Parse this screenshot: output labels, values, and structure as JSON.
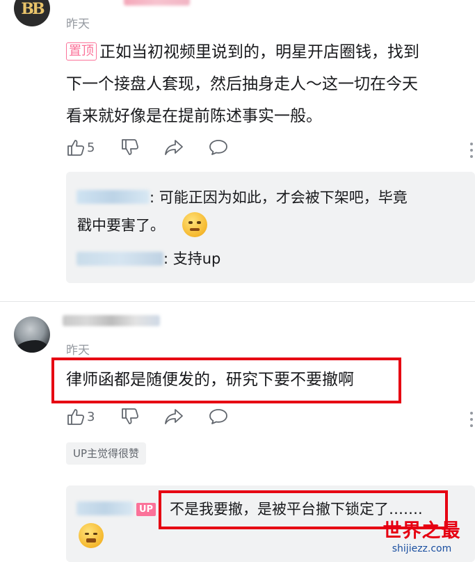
{
  "comments": [
    {
      "avatar_text": "BB",
      "time": "昨天",
      "pinned_label": "置顶",
      "lines": [
        "正如当初视频里说到的，明星开店圈钱，找到",
        "下一个接盘人套现，然后抽身走人～这一切在今天",
        "看来就好像是在提前陈述事实一般。"
      ],
      "like_count": "5",
      "replies": [
        {
          "lines": [
            ": 可能正因为如此，才会被下架吧，毕竟",
            "戳中要害了。"
          ],
          "emoji": "thinking-face-emoji"
        },
        {
          "lines": [
            ": 支持up"
          ]
        }
      ]
    },
    {
      "time": "昨天",
      "lines": [
        "律师函都是随便发的，研究下要不要撤啊"
      ],
      "like_count": "3",
      "up_tag": "UP主觉得很赞",
      "replies": [
        {
          "up_badge": "UP",
          "lines": [
            "不是我要撤，是被平台撤下锁定了……."
          ],
          "emoji": "tired-face-emoji"
        }
      ]
    }
  ],
  "watermark": {
    "title": "世界之最",
    "url": "shijiezz.com"
  },
  "colors": {
    "accent": "#fb7299",
    "highlight": "#e60012",
    "reply_bg": "#f1f2f3",
    "meta_text": "#9499a0"
  }
}
